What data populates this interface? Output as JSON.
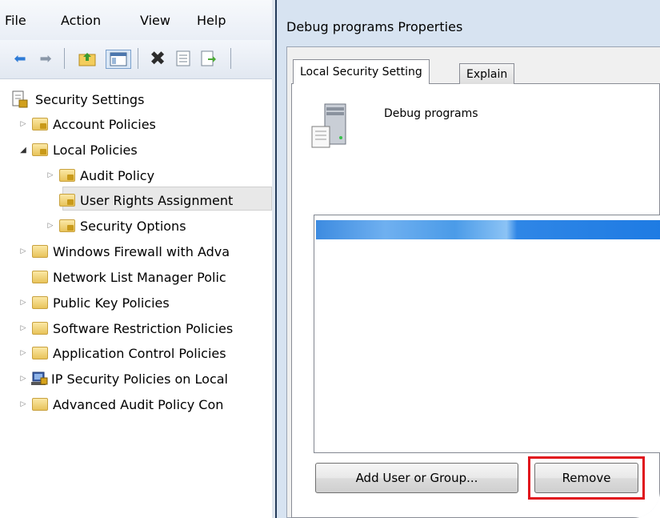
{
  "menubar": {
    "items": [
      "File",
      "Action",
      "View",
      "Help"
    ]
  },
  "toolbar": {
    "icons": [
      "back-arrow-icon",
      "forward-arrow-icon",
      "up-folder-icon",
      "show-hide-tree-icon",
      "delete-icon",
      "properties-icon",
      "export-list-icon"
    ]
  },
  "tree": {
    "root": "Security Settings",
    "items": [
      {
        "label": "Account Policies"
      },
      {
        "label": "Local Policies"
      },
      {
        "label": "Audit Policy"
      },
      {
        "label": "User Rights Assignment"
      },
      {
        "label": "Security Options"
      },
      {
        "label": "Windows Firewall with Adva"
      },
      {
        "label": "Network List Manager Polic"
      },
      {
        "label": "Public Key Policies"
      },
      {
        "label": "Software Restriction Policies"
      },
      {
        "label": "Application Control Policies"
      },
      {
        "label": "IP Security Policies on Local"
      },
      {
        "label": "Advanced Audit Policy Con"
      }
    ]
  },
  "dialog": {
    "title": "Debug programs Properties",
    "tabs": [
      "Local Security Setting",
      "Explain"
    ],
    "active_tab": "Local Security Setting",
    "policy_name": "Debug programs",
    "add_button": "Add User or Group...",
    "remove_button": "Remove"
  },
  "colors": {
    "highlight": "#e0121c",
    "selection": "#3d8be0",
    "dialog_frame": "#d7e3f1"
  }
}
